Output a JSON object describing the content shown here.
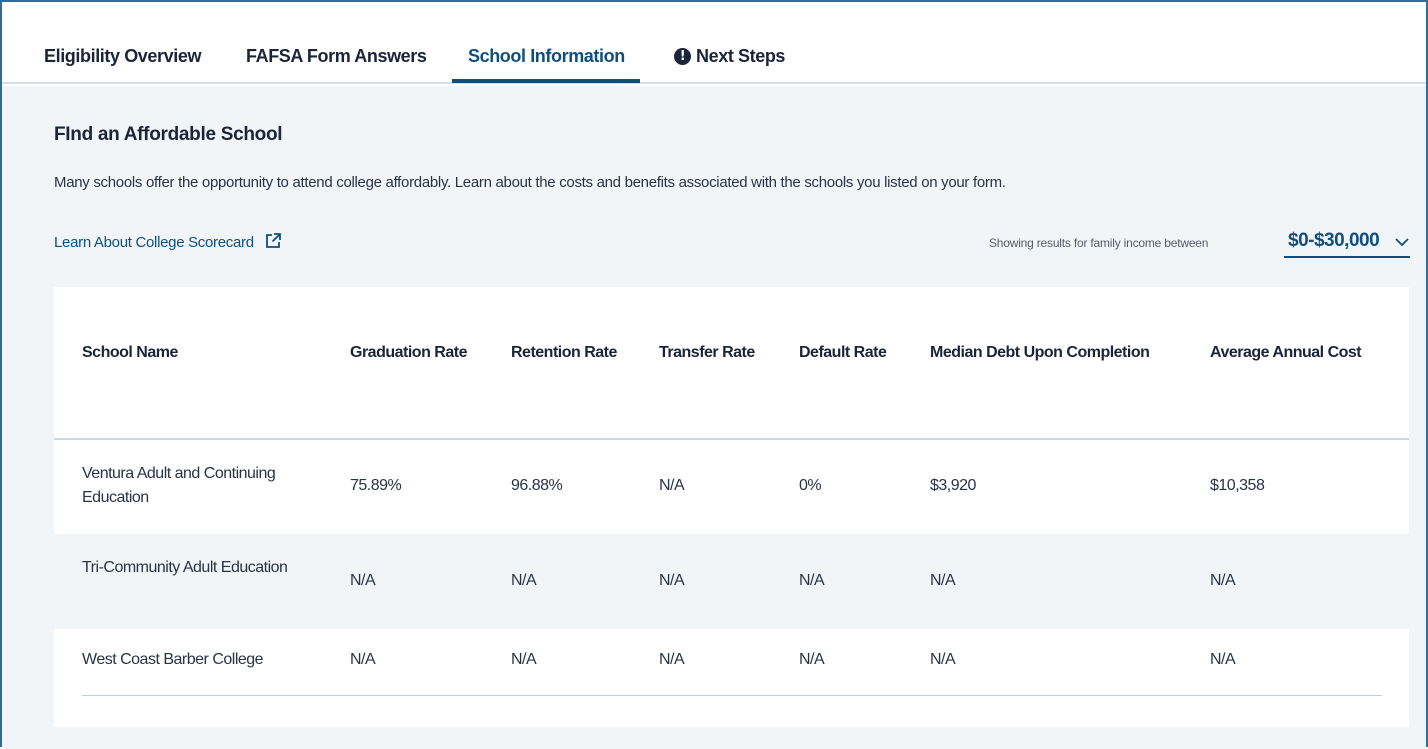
{
  "tabs": [
    {
      "label": "Eligibility Overview"
    },
    {
      "label": "FAFSA Form Answers"
    },
    {
      "label": "School Information"
    },
    {
      "label": "Next Steps"
    }
  ],
  "section": {
    "title": "FInd an Affordable School",
    "description": "Many schools offer the opportunity to attend college affordably. Learn about the costs and benefits associated with the schools you listed on your form.",
    "scorecard_link": "Learn About College Scorecard",
    "income_label": "Showing results for family income between",
    "income_value": "$0-$30,000"
  },
  "table": {
    "headers": [
      "School Name",
      "Graduation Rate",
      "Retention Rate",
      "Transfer Rate",
      "Default Rate",
      "Median Debt Upon Completion",
      "Average Annual Cost"
    ],
    "rows": [
      [
        "Ventura Adult and Continuing Education",
        "75.89%",
        "96.88%",
        "N/A",
        "0%",
        "$3,920",
        "$10,358"
      ],
      [
        "Tri-Community Adult Education",
        "N/A",
        "N/A",
        "N/A",
        "N/A",
        "N/A",
        "N/A"
      ],
      [
        "West Coast Barber College",
        "N/A",
        "N/A",
        "N/A",
        "N/A",
        "N/A",
        "N/A"
      ]
    ]
  },
  "icons": {
    "next_steps": "info-icon",
    "scorecard": "external-link-icon",
    "income": "chevron-down-icon"
  },
  "colors": {
    "accent": "#0e4f7f",
    "frame_border": "#2c6da0",
    "background": "#f2f5f8"
  }
}
